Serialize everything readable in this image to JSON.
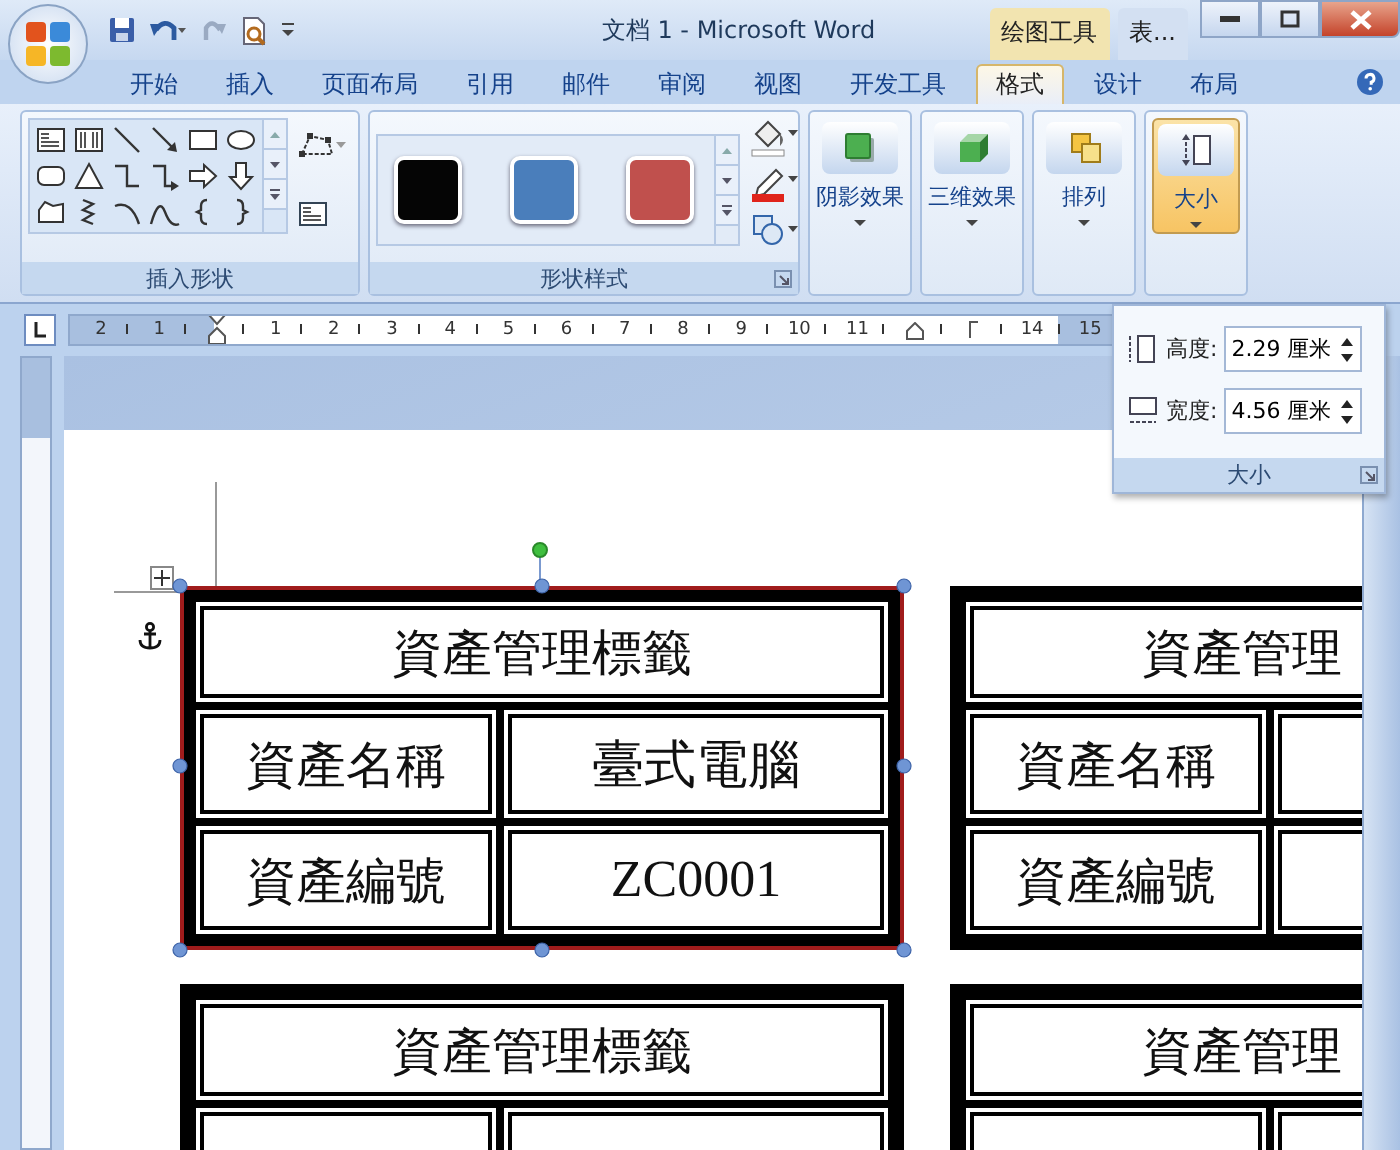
{
  "window": {
    "title": "文档 1 - Microsoft Word",
    "context_tabs": [
      {
        "label": "绘图工具",
        "color": "#f2e4b0"
      },
      {
        "label": "表...",
        "color": "#d3e0f2"
      }
    ]
  },
  "ribbon_tabs": [
    {
      "label": "开始",
      "selected": false
    },
    {
      "label": "插入",
      "selected": false
    },
    {
      "label": "页面布局",
      "selected": false
    },
    {
      "label": "引用",
      "selected": false
    },
    {
      "label": "邮件",
      "selected": false
    },
    {
      "label": "审阅",
      "selected": false
    },
    {
      "label": "视图",
      "selected": false
    },
    {
      "label": "开发工具",
      "selected": false
    },
    {
      "label": "格式",
      "selected": true
    },
    {
      "label": "设计",
      "selected": false
    },
    {
      "label": "布局",
      "selected": false
    }
  ],
  "ribbon": {
    "shape_group": {
      "label": "插入形状"
    },
    "style_group": {
      "label": "形状样式",
      "swatches": [
        {
          "color": "#050505"
        },
        {
          "color": "#4a7ebb"
        },
        {
          "color": "#c0504d"
        }
      ]
    },
    "buttons": [
      {
        "label": "阴影效果",
        "kind": "shadow",
        "pressed": false
      },
      {
        "label": "三维效果",
        "kind": "cube",
        "pressed": false
      },
      {
        "label": "排列",
        "kind": "arrange",
        "pressed": false
      },
      {
        "label": "大小",
        "kind": "size",
        "pressed": true
      }
    ]
  },
  "ruler": {
    "marks": [
      {
        "kind": "number",
        "label": "2"
      },
      {
        "kind": "number",
        "label": "1"
      },
      {
        "kind": "indent"
      },
      {
        "kind": "number",
        "label": "1"
      },
      {
        "kind": "number",
        "label": "2"
      },
      {
        "kind": "number",
        "label": "3"
      },
      {
        "kind": "number",
        "label": "4"
      },
      {
        "kind": "number",
        "label": "5"
      },
      {
        "kind": "number",
        "label": "6"
      },
      {
        "kind": "number",
        "label": "7"
      },
      {
        "kind": "number",
        "label": "8"
      },
      {
        "kind": "number",
        "label": "9"
      },
      {
        "kind": "number",
        "label": "10"
      },
      {
        "kind": "number",
        "label": "11"
      },
      {
        "kind": "right-indent"
      },
      {
        "kind": "margin"
      },
      {
        "kind": "number",
        "label": "14"
      },
      {
        "kind": "number",
        "label": "15"
      }
    ]
  },
  "size_panel": {
    "label": "大小",
    "fields": [
      {
        "kind": "height",
        "label": "高度:",
        "value": "2.29 厘米"
      },
      {
        "kind": "width",
        "label": "宽度:",
        "value": "4.56 厘米"
      }
    ]
  },
  "labels": [
    {
      "title": "資產管理標籤",
      "selected": true,
      "rows": [
        {
          "name": "資產名稱",
          "value": "臺式電腦"
        },
        {
          "name": "資產編號",
          "value": "ZC0001"
        }
      ]
    },
    {
      "title": "資產管理",
      "selected": false,
      "rows": [
        {
          "name": "資產名稱"
        },
        {
          "name": "資產編號"
        }
      ]
    },
    {
      "title": "資產管理標籤",
      "selected": false
    },
    {
      "title": "資產管理",
      "selected": false
    }
  ]
}
